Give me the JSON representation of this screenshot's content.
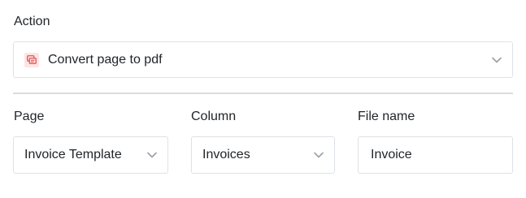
{
  "action": {
    "label": "Action",
    "selected": "Convert page to pdf",
    "icon": "pdf-icon",
    "icon_color": "#e05353"
  },
  "page": {
    "label": "Page",
    "selected": "Invoice Template"
  },
  "column": {
    "label": "Column",
    "selected": "Invoices"
  },
  "file_name": {
    "label": "File name",
    "value": "Invoice"
  }
}
